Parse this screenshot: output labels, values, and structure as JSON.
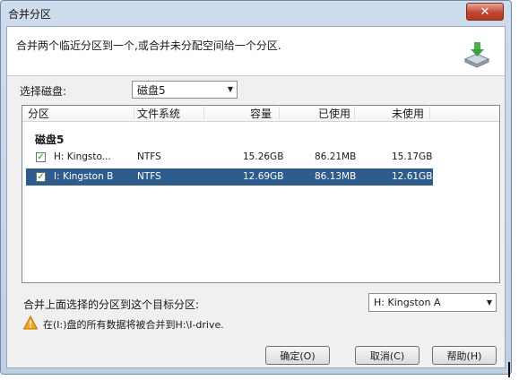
{
  "window": {
    "title": "合并分区",
    "close_glyph": "✕"
  },
  "header": {
    "description": "合并两个临近分区到一个,或合并未分配空间给一个分区.",
    "icon": "merge-partition-icon"
  },
  "disk_select": {
    "label": "选择磁盘:",
    "value": "磁盘5"
  },
  "table": {
    "columns": [
      "分区",
      "文件系统",
      "容量",
      "已使用",
      "未使用"
    ],
    "group": "磁盘5",
    "rows": [
      {
        "checked": true,
        "partition": "H:  Kingsto...",
        "fs": "NTFS",
        "capacity": "15.26GB",
        "used": "86.21MB",
        "free": "15.17GB",
        "selected": false
      },
      {
        "checked": true,
        "partition": "I:  Kingston B",
        "fs": "NTFS",
        "capacity": "12.69GB",
        "used": "86.13MB",
        "free": "12.61GB",
        "selected": true
      }
    ]
  },
  "target": {
    "label": "合并上面选择的分区到这个目标分区:",
    "value": "H:  Kingston A"
  },
  "warning": {
    "text": "在(I:)盘的所有数据将被合并到H:\\I-drive."
  },
  "buttons": {
    "ok": "确定(O)",
    "cancel": "取消(C)",
    "help": "帮助(H)"
  },
  "colors": {
    "selection": "#2e5c8c",
    "close": "#c0452f",
    "title_bg": "#cfdcec"
  }
}
